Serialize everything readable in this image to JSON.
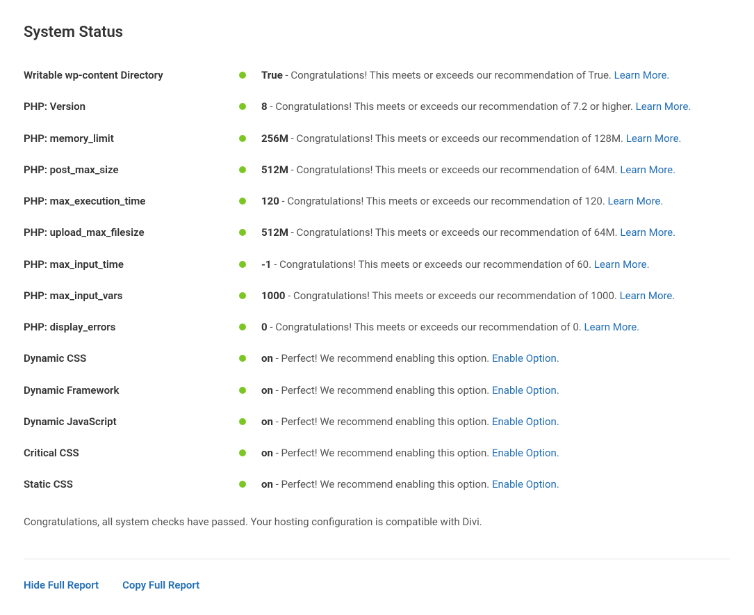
{
  "title": "System Status",
  "items": [
    {
      "label": "Writable wp-content Directory",
      "value": "True",
      "message": " - Congratulations! This meets or exceeds our recommendation of True. ",
      "link": "Learn More."
    },
    {
      "label": "PHP: Version",
      "value": "8",
      "message": " - Congratulations! This meets or exceeds our recommendation of 7.2 or higher. ",
      "link": "Learn More."
    },
    {
      "label": "PHP: memory_limit",
      "value": "256M",
      "message": " - Congratulations! This meets or exceeds our recommendation of 128M. ",
      "link": "Learn More."
    },
    {
      "label": "PHP: post_max_size",
      "value": "512M",
      "message": " - Congratulations! This meets or exceeds our recommendation of 64M. ",
      "link": "Learn More."
    },
    {
      "label": "PHP: max_execution_time",
      "value": "120",
      "message": " - Congratulations! This meets or exceeds our recommendation of 120. ",
      "link": "Learn More."
    },
    {
      "label": "PHP: upload_max_filesize",
      "value": "512M",
      "message": " - Congratulations! This meets or exceeds our recommendation of 64M. ",
      "link": "Learn More."
    },
    {
      "label": "PHP: max_input_time",
      "value": "-1",
      "message": " - Congratulations! This meets or exceeds our recommendation of 60. ",
      "link": "Learn More."
    },
    {
      "label": "PHP: max_input_vars",
      "value": "1000",
      "message": " - Congratulations! This meets or exceeds our recommendation of 1000. ",
      "link": "Learn More."
    },
    {
      "label": "PHP: display_errors",
      "value": "0",
      "message": " - Congratulations! This meets or exceeds our recommendation of 0. ",
      "link": "Learn More."
    },
    {
      "label": "Dynamic CSS",
      "value": "on",
      "message": " - Perfect! We recommend enabling this option. ",
      "link": "Enable Option."
    },
    {
      "label": "Dynamic Framework",
      "value": "on",
      "message": " - Perfect! We recommend enabling this option. ",
      "link": "Enable Option."
    },
    {
      "label": "Dynamic JavaScript",
      "value": "on",
      "message": " - Perfect! We recommend enabling this option. ",
      "link": "Enable Option."
    },
    {
      "label": "Critical CSS",
      "value": "on",
      "message": " - Perfect! We recommend enabling this option. ",
      "link": "Enable Option."
    },
    {
      "label": "Static CSS",
      "value": "on",
      "message": " - Perfect! We recommend enabling this option. ",
      "link": "Enable Option."
    }
  ],
  "summary": "Congratulations, all system checks have passed. Your hosting configuration is compatible with Divi.",
  "actions": {
    "hide": "Hide Full Report",
    "copy": "Copy Full Report"
  }
}
